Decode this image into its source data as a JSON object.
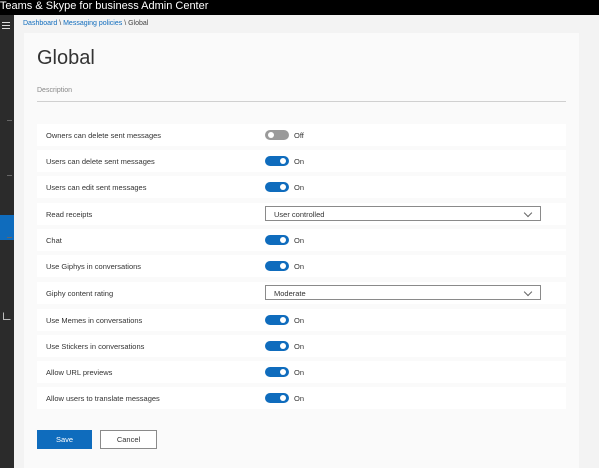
{
  "window": {
    "title": "t Teams & Skype for business Admin Center"
  },
  "breadcrumb": {
    "dashboard": "Dashboard",
    "sep1": " \\ ",
    "messaging_policies": "Messaging policies",
    "sep2": " \\ ",
    "current": "Global"
  },
  "page": {
    "title": "Global",
    "description_label": "Description"
  },
  "settings": [
    {
      "label": "Owners can delete sent messages",
      "type": "toggle",
      "on": false,
      "state": "Off"
    },
    {
      "label": "Users can delete sent messages",
      "type": "toggle",
      "on": true,
      "state": "On"
    },
    {
      "label": "Users can edit sent messages",
      "type": "toggle",
      "on": true,
      "state": "On"
    },
    {
      "label": "Read receipts",
      "type": "select",
      "value": "User controlled"
    },
    {
      "label": "Chat",
      "type": "toggle",
      "on": true,
      "state": "On"
    },
    {
      "label": "Use Giphys in conversations",
      "type": "toggle",
      "on": true,
      "state": "On"
    },
    {
      "label": "Giphy content rating",
      "type": "select",
      "value": "Moderate"
    },
    {
      "label": "Use Memes in conversations",
      "type": "toggle",
      "on": true,
      "state": "On"
    },
    {
      "label": "Use Stickers in conversations",
      "type": "toggle",
      "on": true,
      "state": "On"
    },
    {
      "label": "Allow URL previews",
      "type": "toggle",
      "on": true,
      "state": "On"
    },
    {
      "label": "Allow users to translate messages",
      "type": "toggle",
      "on": true,
      "state": "On"
    }
  ],
  "actions": {
    "save": "Save",
    "cancel": "Cancel"
  },
  "colors": {
    "accent": "#0f6cbd",
    "toggle_off": "#9a9a9a",
    "nav_bg": "#2b2b2b"
  },
  "icons": {
    "menu": "hamburger-icon",
    "external_link": "external-link-icon",
    "dropdown": "chevron-down-icon"
  }
}
